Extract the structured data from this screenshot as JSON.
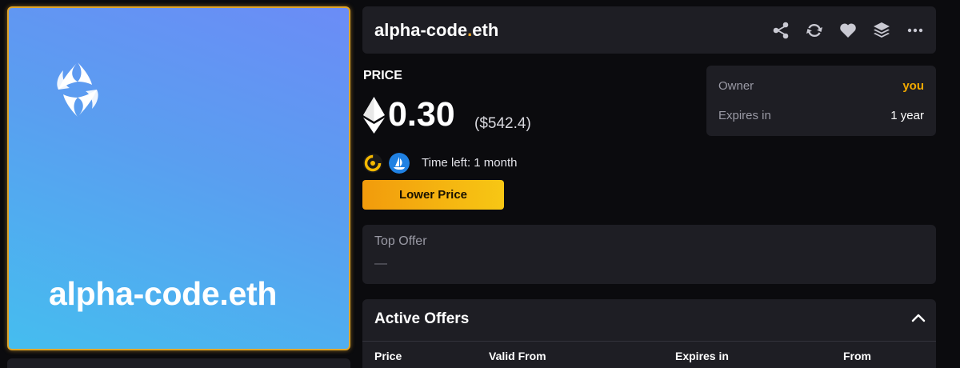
{
  "nft": {
    "name": "alpha-code.eth",
    "border_color": "#e0a52a"
  },
  "header": {
    "title_main": "alpha-code",
    "title_dot": ".",
    "title_tld": "eth",
    "actions": [
      "share-icon",
      "refresh-icon",
      "heart-icon",
      "layers-icon",
      "more-icon"
    ]
  },
  "price": {
    "label": "PRICE",
    "value": "0.30",
    "usd": "($542.4)"
  },
  "listing": {
    "marketplaces": [
      "ens-vision",
      "opensea"
    ],
    "time_left": "Time left:  1 month",
    "lower_price_label": "Lower Price"
  },
  "owner_card": {
    "owner_label": "Owner",
    "owner_value": "you",
    "expires_label": "Expires in",
    "expires_value": "1 year"
  },
  "top_offer": {
    "label": "Top Offer",
    "value": "—"
  },
  "active_offers": {
    "title": "Active Offers",
    "columns": [
      "Price",
      "Valid From",
      "Expires in",
      "From"
    ]
  },
  "colors": {
    "accent": "#f5a623",
    "panel": "#1e1e24",
    "background": "#0b0b0e"
  }
}
